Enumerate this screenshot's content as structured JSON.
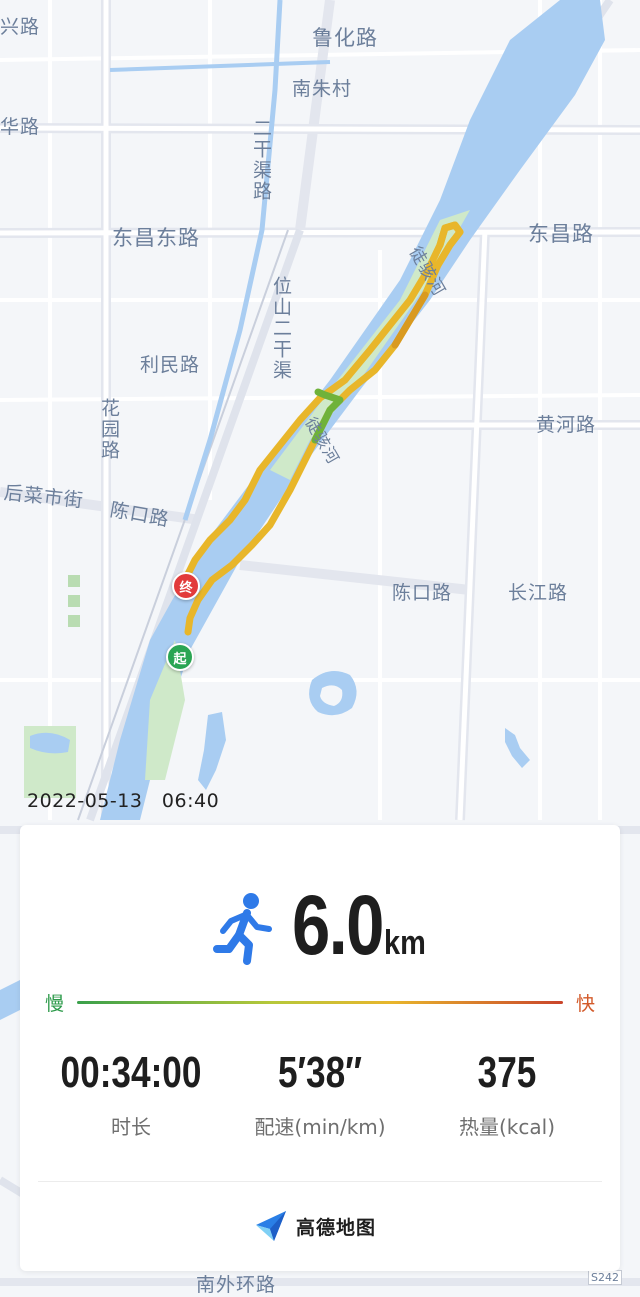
{
  "map": {
    "labels": {
      "xing_road": "兴路",
      "luhua_road": "鲁化路",
      "nanzhu_village": "南朱村",
      "hua_road": "华路",
      "erganqu": "二干渠路",
      "dongchang_east": "东昌东路",
      "dongchang_road": "东昌路",
      "tuhai_river_1": "徒骇河",
      "tuhai_river_2": "徒骇河",
      "weishan_canal": "位山二干渠",
      "limin_road": "利民路",
      "huayuan_road": "花园路",
      "huanghe_road": "黄河路",
      "houcai_street": "后菜市街",
      "chenkou_road_1": "陈口路",
      "chenkou_road_2": "陈口路",
      "changjiang_road": "长江路",
      "nanwai_ring": "南外环路",
      "route_s242": "S242"
    },
    "markers": {
      "end": "终",
      "start": "起"
    }
  },
  "timestamp": "2022-05-13　06:40",
  "summary": {
    "distance_value": "6.0",
    "distance_unit": "km",
    "pace_slow_label": "慢",
    "pace_fast_label": "快",
    "stats": {
      "duration": {
        "value": "00:34:00",
        "label": "时长"
      },
      "pace": {
        "value": "5′38″",
        "label": "配速(min/km)"
      },
      "calories": {
        "value": "375",
        "label": "热量(kcal)"
      }
    },
    "brand": "高德地图"
  },
  "colors": {
    "route": "#e8b62a",
    "route_fast": "#d99a20",
    "route_slow": "#6fb23a",
    "water": "#a9cdf2",
    "park": "#cfe9c9",
    "runner_icon": "#2f7ae8",
    "pace_slow": "#2c9a4a",
    "pace_fast": "#d35a2a"
  },
  "icons": [
    "runner-icon",
    "gaode-logo-icon"
  ]
}
